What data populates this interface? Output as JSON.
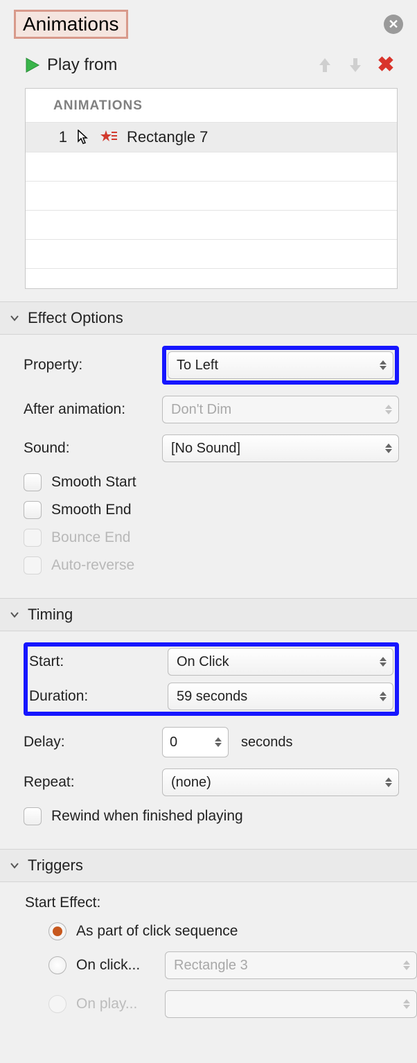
{
  "header": {
    "title": "Animations"
  },
  "play": {
    "label": "Play from"
  },
  "list": {
    "header": "ANIMATIONS",
    "items": [
      {
        "index": "1",
        "object": "Rectangle 7"
      }
    ]
  },
  "sections": {
    "effect": {
      "title": "Effect Options",
      "property_label": "Property:",
      "property_value": "To Left",
      "after_label": "After animation:",
      "after_value": "Don't Dim",
      "sound_label": "Sound:",
      "sound_value": "[No Sound]",
      "smooth_start": "Smooth Start",
      "smooth_end": "Smooth End",
      "bounce_end": "Bounce End",
      "auto_reverse": "Auto-reverse"
    },
    "timing": {
      "title": "Timing",
      "start_label": "Start:",
      "start_value": "On Click",
      "duration_label": "Duration:",
      "duration_value": "59 seconds",
      "delay_label": "Delay:",
      "delay_value": "0",
      "delay_unit": "seconds",
      "repeat_label": "Repeat:",
      "repeat_value": "(none)",
      "rewind": "Rewind when finished playing"
    },
    "triggers": {
      "title": "Triggers",
      "start_effect": "Start Effect:",
      "opt_sequence": "As part of click sequence",
      "opt_onclick": "On click...",
      "opt_onclick_target": "Rectangle 3",
      "opt_onplay": "On play..."
    }
  }
}
